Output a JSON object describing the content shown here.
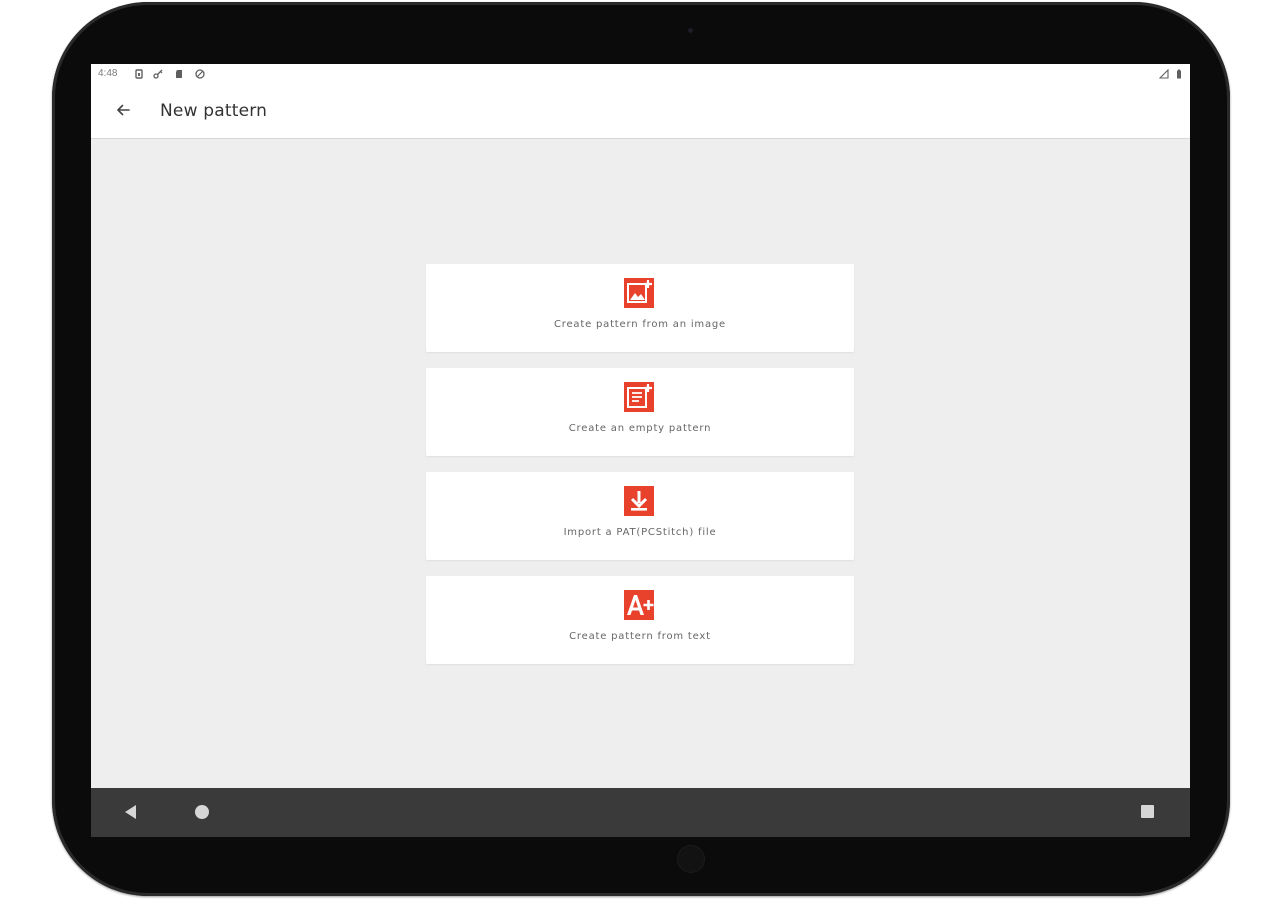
{
  "status_bar": {
    "time": "4:48",
    "left_icons": [
      "sim-icon",
      "key-icon",
      "sd-card-icon",
      "vpn-icon"
    ],
    "right_icons": [
      "signal-icon",
      "battery-icon"
    ]
  },
  "app_bar": {
    "back_icon": "arrow-back-icon",
    "title": "New pattern"
  },
  "accent_color": "#e8412c",
  "options": [
    {
      "label": "Create pattern from an image",
      "icon": "add-image-icon"
    },
    {
      "label": "Create an empty pattern",
      "icon": "new-document-icon"
    },
    {
      "label": "Import a PAT(PCStitch) file",
      "icon": "download-icon"
    },
    {
      "label": "Create pattern from text",
      "icon": "add-text-icon"
    }
  ],
  "nav_bar": {
    "buttons": [
      "nav-back-icon",
      "nav-home-icon",
      "nav-recents-icon"
    ]
  }
}
